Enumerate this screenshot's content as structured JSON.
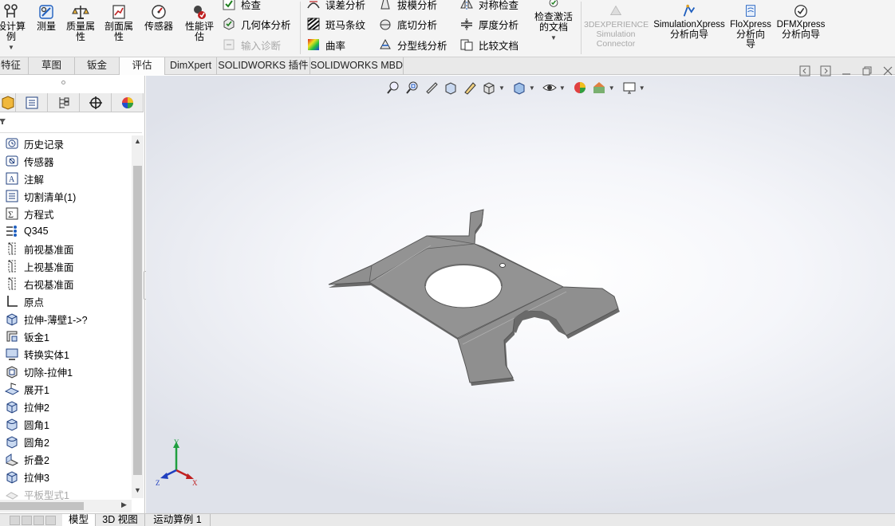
{
  "ribbon": {
    "big_buttons": [
      {
        "id": "design-study",
        "label1": "设计算",
        "label2": "例",
        "has_dropdown": true,
        "icon": "design-study-icon"
      },
      {
        "id": "measure",
        "label1": "测量",
        "label2": "",
        "icon": "measure-icon"
      },
      {
        "id": "mass-props",
        "label1": "质量属",
        "label2": "性",
        "icon": "mass-properties-icon"
      },
      {
        "id": "section-props",
        "label1": "剖面属",
        "label2": "性",
        "icon": "section-properties-icon"
      },
      {
        "id": "sensor",
        "label1": "传感器",
        "label2": "",
        "icon": "sensor-icon"
      },
      {
        "id": "perf-eval",
        "label1": "性能评",
        "label2": "估",
        "icon": "performance-evaluation-icon"
      }
    ],
    "small_col1": [
      {
        "label": "检查",
        "icon": "check-icon"
      },
      {
        "label": "几何体分析",
        "icon": "geometry-analysis-icon"
      },
      {
        "label": "输入诊断",
        "icon": "import-diagnostics-icon",
        "disabled": true
      }
    ],
    "small_col2": [
      {
        "label": "误差分析",
        "icon": "deviation-analysis-icon"
      },
      {
        "label": "斑马条纹",
        "icon": "zebra-stripes-icon"
      },
      {
        "label": "曲率",
        "icon": "curvature-icon"
      }
    ],
    "small_col3": [
      {
        "label": "拔模分析",
        "icon": "draft-analysis-icon"
      },
      {
        "label": "底切分析",
        "icon": "undercut-analysis-icon"
      },
      {
        "label": "分型线分析",
        "icon": "parting-line-analysis-icon"
      }
    ],
    "small_col4": [
      {
        "label": "对称检查",
        "icon": "symmetry-check-icon"
      },
      {
        "label": "厚度分析",
        "icon": "thickness-analysis-icon"
      },
      {
        "label": "比较文档",
        "icon": "compare-documents-icon"
      }
    ],
    "activate_doc": {
      "label1": "检查激活",
      "label2": "的文档",
      "icon": "check-active-document-icon"
    },
    "sim_connector": {
      "line1": "3DEXPERIENCE",
      "line2": "Simulation",
      "line3": "Connector",
      "icon": "simulation-connector-icon"
    },
    "xpress": [
      {
        "line1": "SimulationXpress",
        "line2": "分析向导",
        "line3": "",
        "icon": "simulationxpress-icon"
      },
      {
        "line1": "FloXpress",
        "line2": "分析向",
        "line3": "导",
        "icon": "floxpress-icon"
      },
      {
        "line1": "DFMXpress",
        "line2": "分析向导",
        "line3": "",
        "icon": "dfmxpress-icon"
      }
    ]
  },
  "tabs": [
    "特征",
    "草图",
    "钣金",
    "评估",
    "DimXpert",
    "SOLIDWORKS 插件",
    "SOLIDWORKS MBD"
  ],
  "active_tab": "评估",
  "feature_tree": [
    {
      "label": "历史记录",
      "icon": "history-icon"
    },
    {
      "label": "传感器",
      "icon": "sensors-icon"
    },
    {
      "label": "注解",
      "icon": "annotations-icon"
    },
    {
      "label": "切割清单(1)",
      "icon": "cut-list-icon"
    },
    {
      "label": "方程式",
      "icon": "equations-icon"
    },
    {
      "label": "Q345",
      "icon": "material-icon"
    },
    {
      "label": "前视基准面",
      "icon": "plane-icon"
    },
    {
      "label": "上视基准面",
      "icon": "plane-icon"
    },
    {
      "label": "右视基准面",
      "icon": "plane-icon"
    },
    {
      "label": "原点",
      "icon": "origin-icon"
    },
    {
      "label": "拉伸-薄壁1->?",
      "icon": "extrude-thin-icon"
    },
    {
      "label": "钣金1",
      "icon": "sheet-metal-icon"
    },
    {
      "label": "转换实体1",
      "icon": "convert-entities-icon"
    },
    {
      "label": "切除-拉伸1",
      "icon": "cut-extrude-icon"
    },
    {
      "label": "展开1",
      "icon": "unfold-icon"
    },
    {
      "label": "拉伸2",
      "icon": "extrude-icon"
    },
    {
      "label": "圆角1",
      "icon": "fillet-icon"
    },
    {
      "label": "圆角2",
      "icon": "fillet-icon"
    },
    {
      "label": "折叠2",
      "icon": "fold-icon"
    },
    {
      "label": "拉伸3",
      "icon": "extrude-icon"
    },
    {
      "label": "平板型式1",
      "icon": "flat-pattern-icon",
      "disabled": true
    }
  ],
  "bottom_tabs": [
    "模型",
    "3D 视图",
    "运动算例 1"
  ],
  "active_bottom_tab": "模型",
  "triad": {
    "x": "X",
    "y": "Y",
    "z": "Z"
  },
  "colors": {
    "ribbon_bg": "#f4f4f4",
    "part_gray": "#8f8f8f",
    "part_edge": "#555555",
    "accent": "#1f5fbf"
  }
}
